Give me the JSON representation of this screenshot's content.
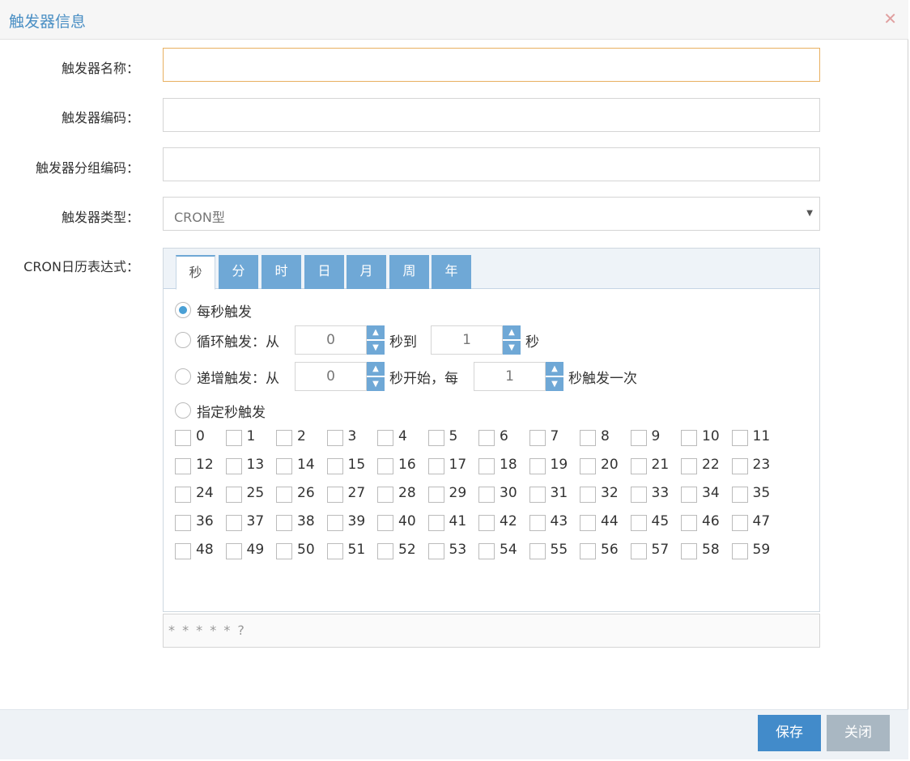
{
  "dialog": {
    "title": "触发器信息"
  },
  "form": {
    "name_label": "触发器名称：",
    "code_label": "触发器编码：",
    "group_label": "触发器分组编码：",
    "type_label": "触发器类型：",
    "type_value": "CRON型",
    "cron_label": "CRON日历表达式："
  },
  "tabs": [
    "秒",
    "分",
    "时",
    "日",
    "月",
    "周",
    "年"
  ],
  "second_panel": {
    "every": "每秒触发",
    "cycle_prefix": "循环触发：从",
    "cycle_from": "0",
    "cycle_mid": "秒到",
    "cycle_to": "1",
    "cycle_suffix": "秒",
    "incr_prefix": "递增触发：从",
    "incr_from": "0",
    "incr_mid": "秒开始，每",
    "incr_step": "1",
    "incr_suffix": "秒触发一次",
    "specify": "指定秒触发"
  },
  "seconds": [
    "0",
    "1",
    "2",
    "3",
    "4",
    "5",
    "6",
    "7",
    "8",
    "9",
    "10",
    "11",
    "12",
    "13",
    "14",
    "15",
    "16",
    "17",
    "18",
    "19",
    "20",
    "21",
    "22",
    "23",
    "24",
    "25",
    "26",
    "27",
    "28",
    "29",
    "30",
    "31",
    "32",
    "33",
    "34",
    "35",
    "36",
    "37",
    "38",
    "39",
    "40",
    "41",
    "42",
    "43",
    "44",
    "45",
    "46",
    "47",
    "48",
    "49",
    "50",
    "51",
    "52",
    "53",
    "54",
    "55",
    "56",
    "57",
    "58",
    "59"
  ],
  "expression": "* * * * * ?",
  "footer": {
    "save_label": "保存",
    "close_label": "关闭"
  },
  "colors": {
    "accent": "#428bca",
    "tab": "#6fa8d6",
    "title": "#4a8fc4"
  }
}
